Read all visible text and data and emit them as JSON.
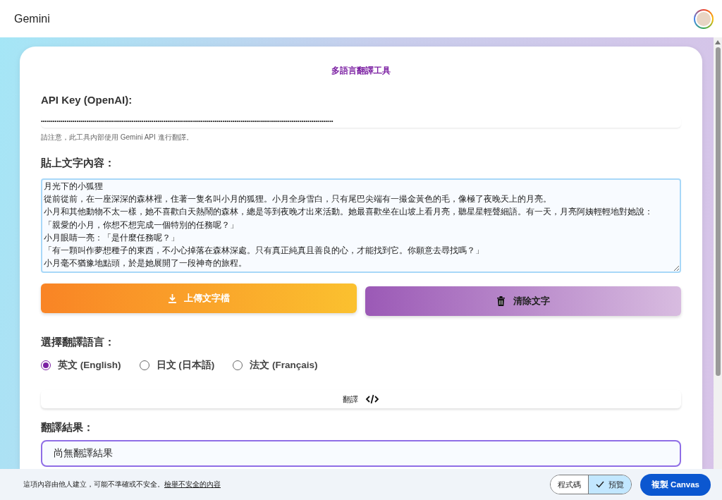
{
  "app_bar": {
    "title": "Gemini"
  },
  "tool": {
    "title": "多語言翻譯工具",
    "api_key": {
      "label": "API Key (OpenAI):",
      "value": "••••••••••••••••••••••••••••••••••••••••••••••••••••••••••••••••••••••••••••••••••••••••••••••••••••••••••••••••••••••••••••••••••••••••••••••••••••",
      "note": "請注意，此工具內部使用 Gemini API 進行翻譯。"
    },
    "text_input": {
      "label": "貼上文字內容：",
      "lines": [
        "月光下的小狐狸",
        "從前從前，在一座深深的森林裡，住著一隻名叫小月的狐狸。小月全身雪白，只有尾巴尖端有一撮金黃色的毛，像極了夜晚天上的月亮。",
        "小月和其他動物不太一樣，她不喜歡白天熱鬧的森林，總是等到夜晚才出來活動。她最喜歡坐在山坡上看月亮，聽星星輕聲細語。有一天，月亮阿姨輕輕地對她說：",
        "「親愛的小月，你想不想完成一個特別的任務呢？」",
        "小月眼睛一亮：「是什麼任務呢？」",
        "「有一顆叫作夢想種子的東西，不小心掉落在森林深處。只有真正純真且善良的心，才能找到它。你願意去尋找嗎？」",
        "小月毫不猶豫地點頭，於是她展開了一段神奇的旅程。"
      ]
    },
    "upload_button": "上傳文字檔",
    "clear_button": "清除文字",
    "language": {
      "label": "選擇翻譯語言：",
      "options": [
        {
          "label": "英文 (English)",
          "selected": true
        },
        {
          "label": "日文 (日本語)",
          "selected": false
        },
        {
          "label": "法文 (Français)",
          "selected": false
        }
      ]
    },
    "translate_button": "翻譯",
    "result": {
      "label": "翻譯結果：",
      "text": "尚無翻譯結果"
    }
  },
  "footer": {
    "disclaimer": "這項內容由他人建立，可能不準確或不安全。",
    "report_link": "檢舉不安全的內容",
    "view_toggle": [
      {
        "label": "程式碼",
        "selected": false
      },
      {
        "label": "預覽",
        "selected": true
      }
    ],
    "copy_button": "複製 Canvas"
  }
}
